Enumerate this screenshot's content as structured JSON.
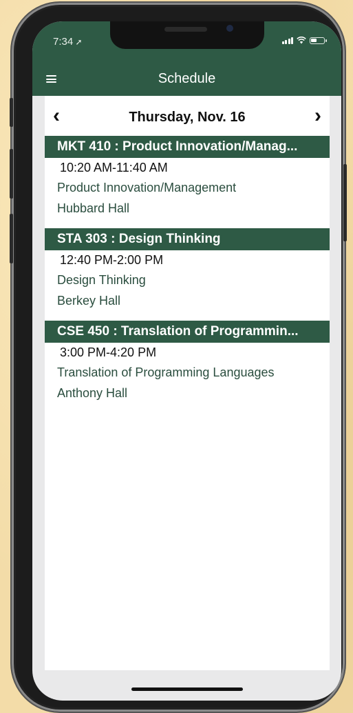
{
  "status_bar": {
    "time": "7:34"
  },
  "header": {
    "title": "Schedule"
  },
  "date_nav": {
    "date": "Thursday, Nov. 16",
    "prev": "‹",
    "next": "›"
  },
  "courses": [
    {
      "title": "MKT 410 : Product Innovation/Manag...",
      "time": "10:20 AM-11:40 AM",
      "name": "Product Innovation/Management",
      "location": "Hubbard Hall"
    },
    {
      "title": "STA 303 : Design Thinking",
      "time": "12:40 PM-2:00 PM",
      "name": "Design Thinking",
      "location": "Berkey Hall"
    },
    {
      "title": "CSE 450 : Translation of Programmin...",
      "time": "3:00 PM-4:20 PM",
      "name": "Translation of Programming Languages",
      "location": "Anthony Hall"
    }
  ],
  "colors": {
    "header": "#2e5a45",
    "link_text": "#2a4d3e",
    "background": "#f3dca8"
  },
  "icons": {
    "menu": "hamburger-menu-icon",
    "prev": "chevron-left-icon",
    "next": "chevron-right-icon"
  }
}
